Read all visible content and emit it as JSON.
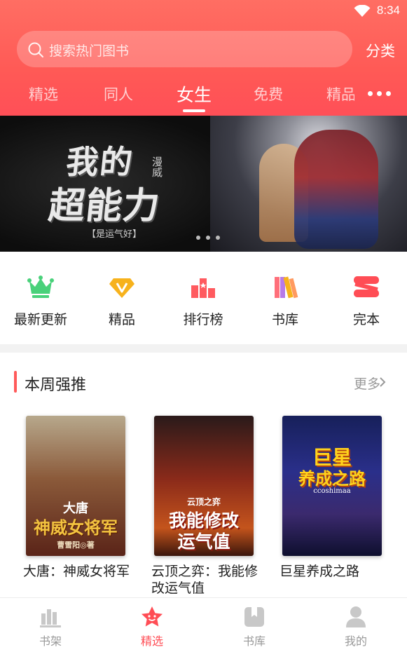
{
  "status_bar": {
    "time": "8:34",
    "wifi_icon": "wifi-icon"
  },
  "header": {
    "search_placeholder": "搜索热门图书",
    "category_label": "分类",
    "tabs": [
      "精选",
      "同人",
      "女生",
      "免费",
      "精品"
    ],
    "active_tab": "女生",
    "more_icon": "more-dots-icon"
  },
  "banner": {
    "title_line1": "我的",
    "title_line2": "超能力",
    "tag": "漫威",
    "subtitle": "【是运气好】",
    "slides": 3
  },
  "quick_nav": [
    {
      "label": "最新更新",
      "icon": "crown-icon"
    },
    {
      "label": "精品",
      "icon": "diamond-icon"
    },
    {
      "label": "排行榜",
      "icon": "ranking-icon"
    },
    {
      "label": "书库",
      "icon": "books-icon"
    },
    {
      "label": "完本",
      "icon": "finished-icon"
    }
  ],
  "section": {
    "title": "本周强推",
    "more_label": "更多"
  },
  "books": [
    {
      "title": "大唐：神威女将军",
      "cover_title": "神威女将军",
      "cover_prefix": "大唐",
      "cover_author": "曹雪阳◎著"
    },
    {
      "title": "云顶之弈：我能修改运气值",
      "cover_title_1": "我能修改",
      "cover_title_2": "运气值",
      "cover_prefix": "云顶之弈"
    },
    {
      "title": "巨星养成之路",
      "cover_title_1": "巨星",
      "cover_title_2": "养成之路",
      "cover_sub": "ccoshimaa"
    }
  ],
  "bottom_nav": [
    {
      "label": "书架",
      "icon": "bookshelf-icon"
    },
    {
      "label": "精选",
      "icon": "featured-icon"
    },
    {
      "label": "书库",
      "icon": "library-icon"
    },
    {
      "label": "我的",
      "icon": "profile-icon"
    }
  ],
  "colors": {
    "accent": "#ff5a56",
    "active_nav": "#ff4d55"
  }
}
